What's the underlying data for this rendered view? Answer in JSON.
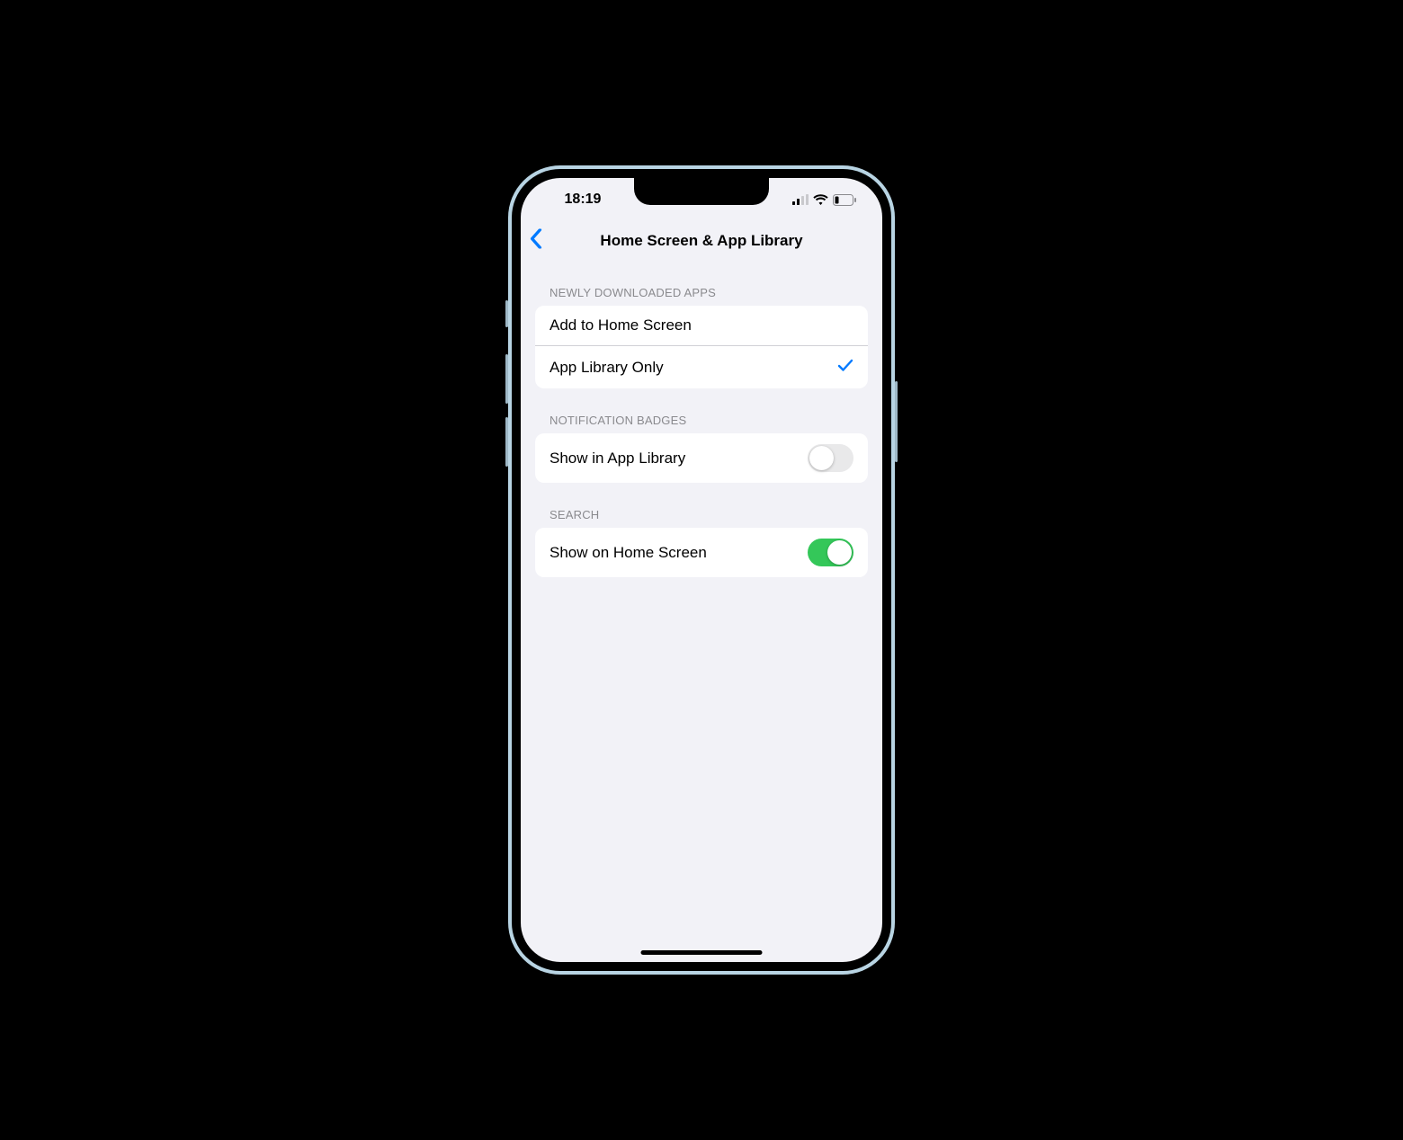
{
  "status": {
    "time": "18:19"
  },
  "nav": {
    "title": "Home Screen & App Library"
  },
  "sections": {
    "newly_downloaded": {
      "header": "Newly Downloaded Apps",
      "option_add": "Add to Home Screen",
      "option_library": "App Library Only",
      "selected": "library"
    },
    "notification_badges": {
      "header": "Notification Badges",
      "show_in_library": "Show in App Library",
      "show_in_library_on": false
    },
    "search": {
      "header": "Search",
      "show_on_home": "Show on Home Screen",
      "show_on_home_on": true
    }
  },
  "colors": {
    "accent": "#007aff",
    "toggle_on": "#34c759",
    "bg": "#f2f2f7"
  }
}
